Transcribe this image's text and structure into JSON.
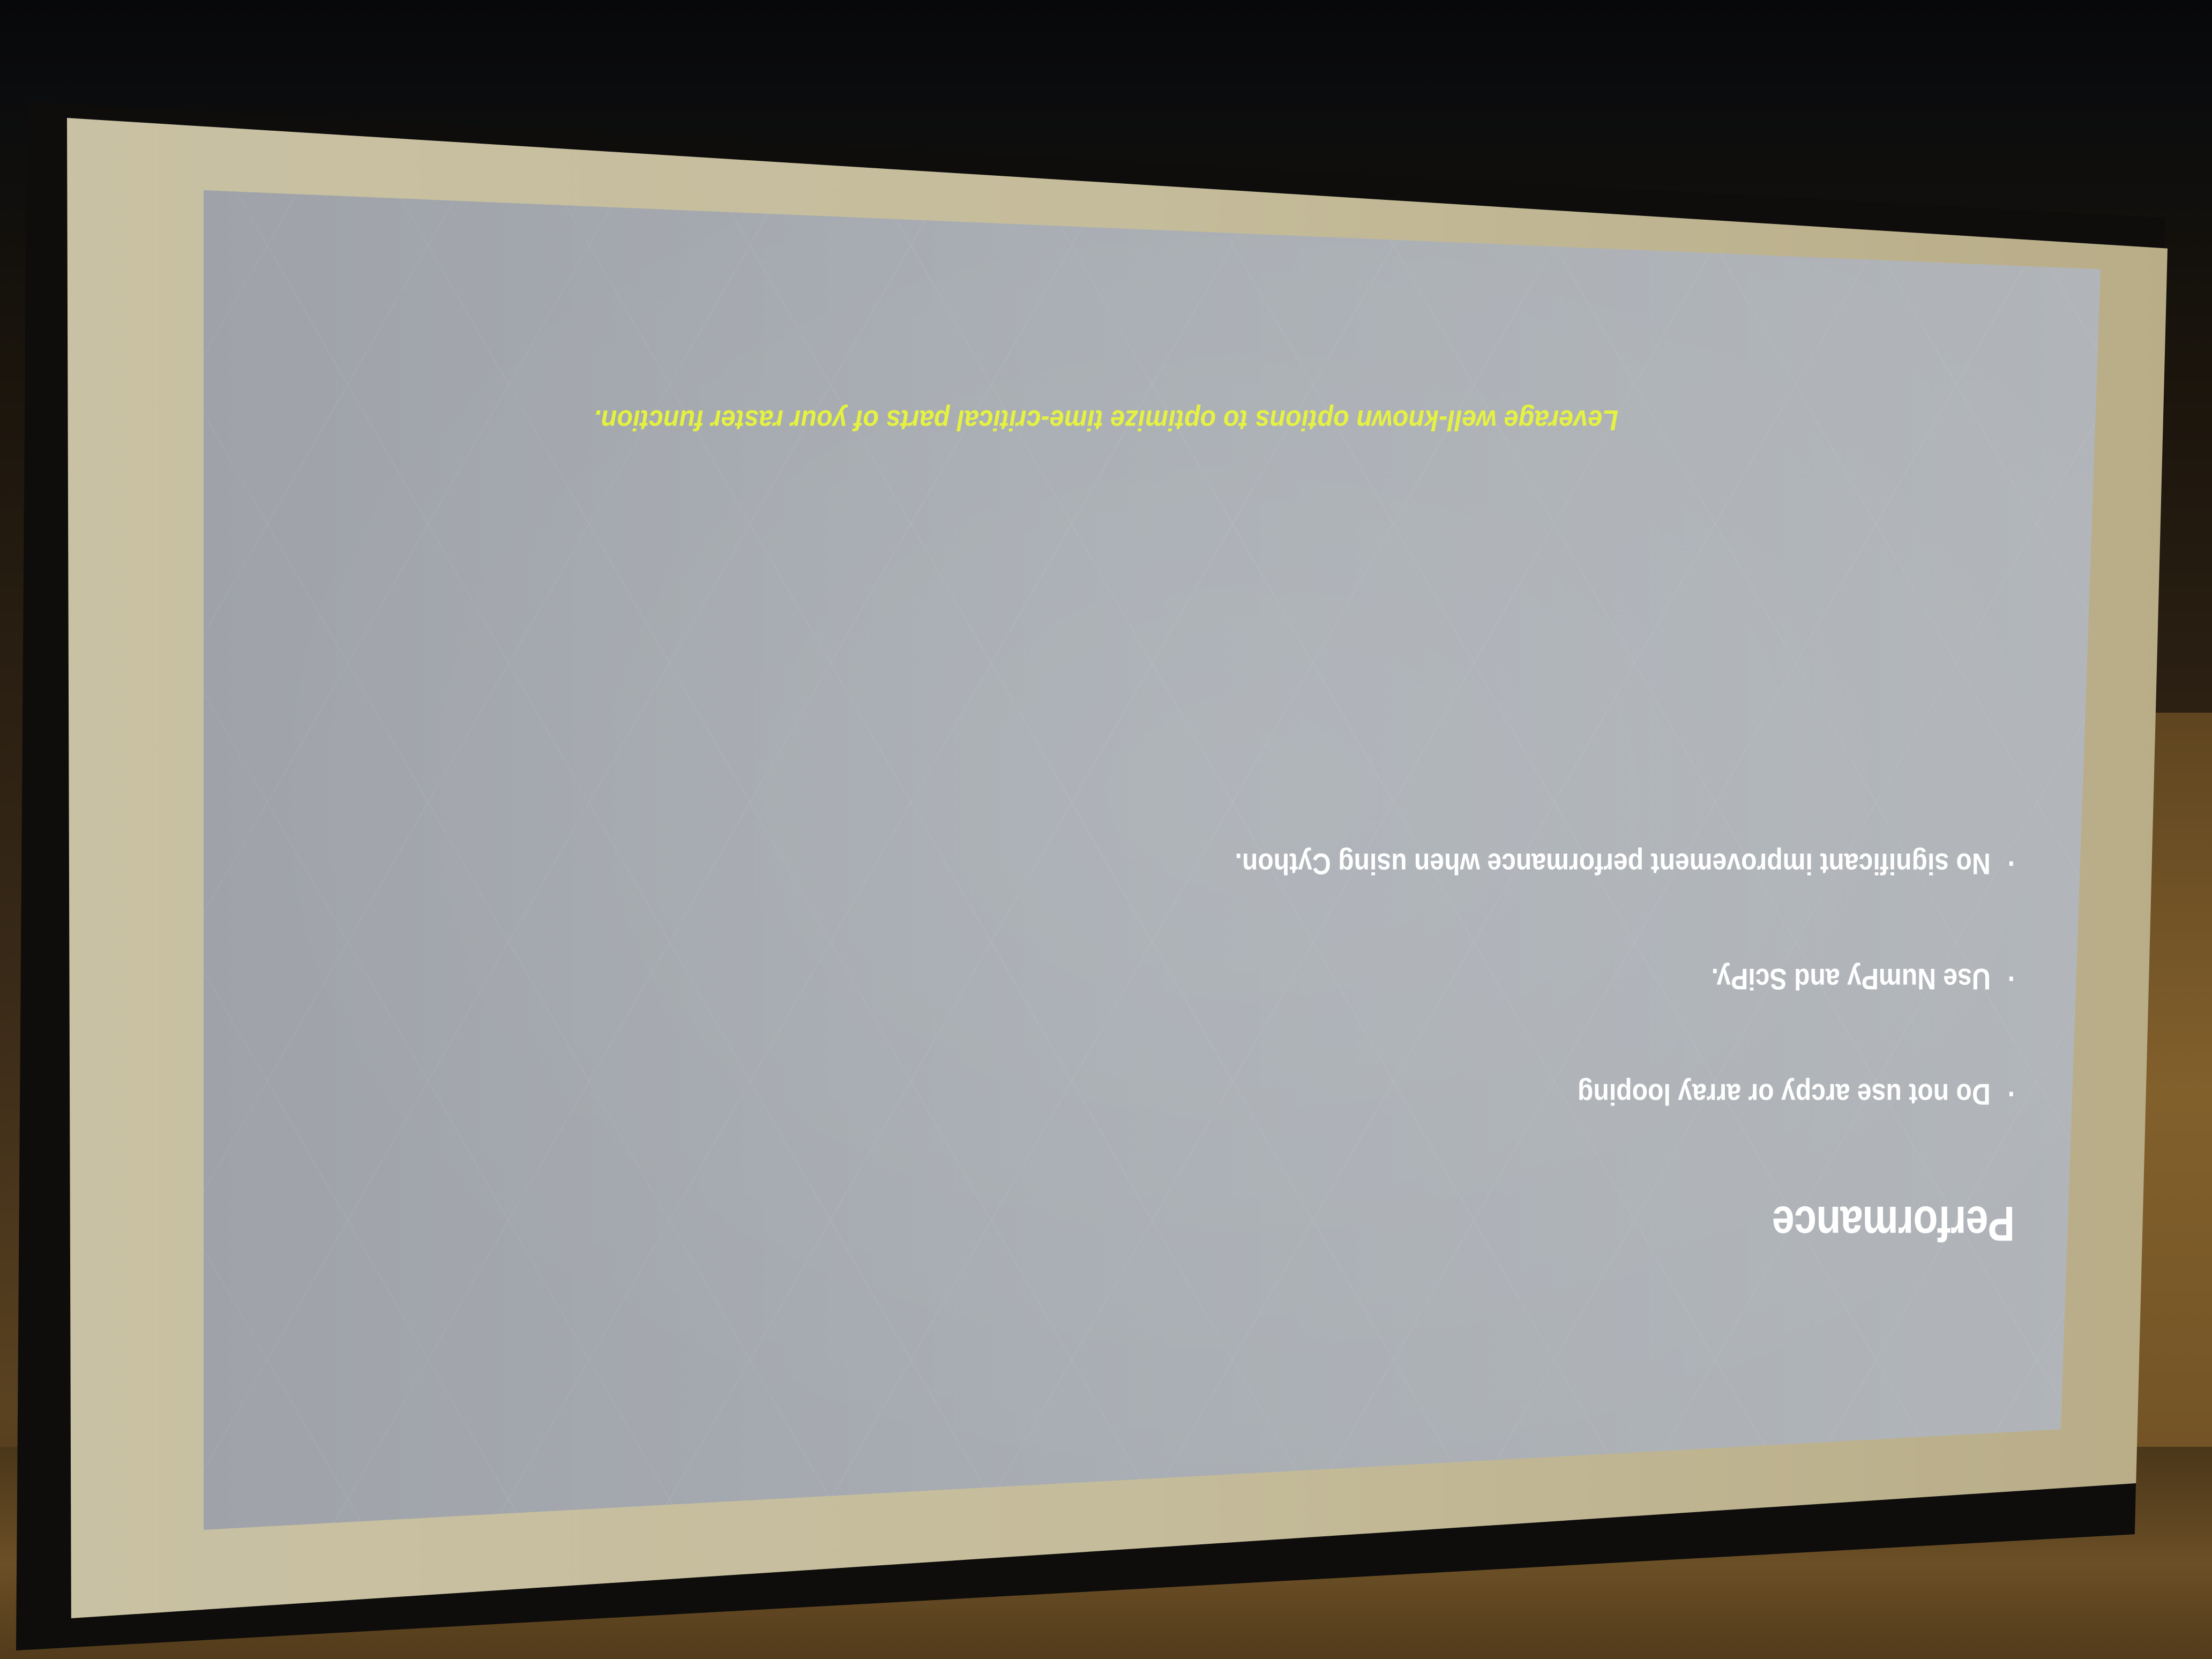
{
  "slide": {
    "title": "Performance",
    "bullets": [
      "Do not use arcpy or array looping",
      "Use NumPy and SciPy.",
      "No significant improvement performance when using Cython."
    ],
    "footer_note": "Leverage well-known options to optimize time-critical parts of your raster function."
  },
  "colors": {
    "slide_background": "#a8adb3",
    "title_text": "#ffffff",
    "footer_note_text": "#e4f23a",
    "screen_border": "#c5bc9b"
  }
}
